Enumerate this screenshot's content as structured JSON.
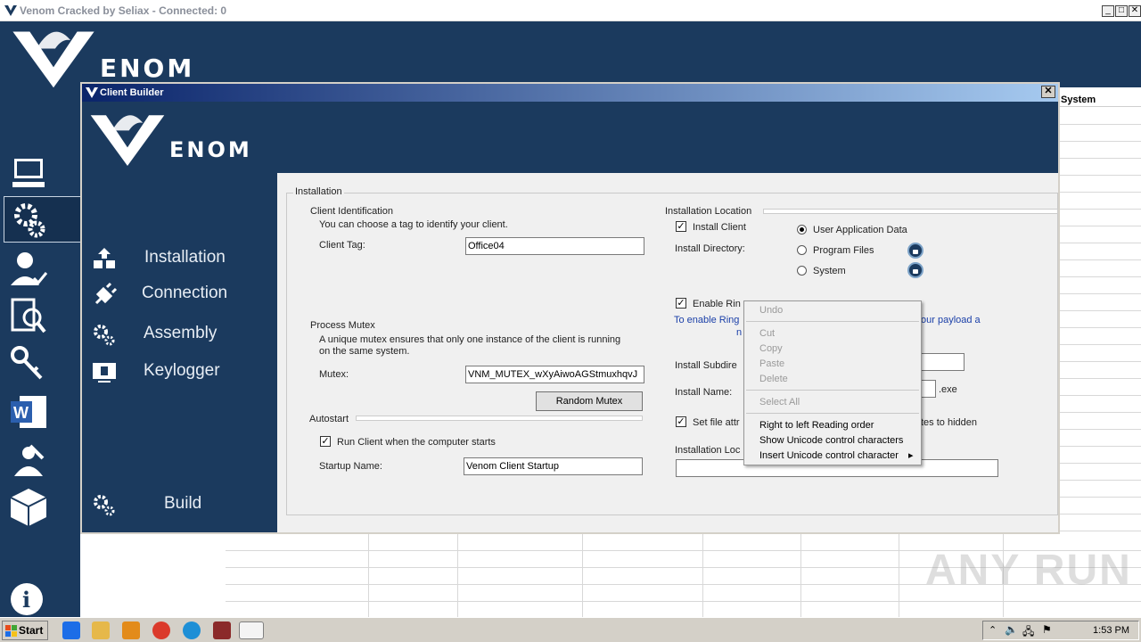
{
  "main_window": {
    "title": "Venom Cracked by Seliax - Connected: 0",
    "brand": "ENOM",
    "system_column_header": "System",
    "about_label": "About",
    "controls": {
      "minimize": "_",
      "maximize": "□",
      "close": "✕"
    }
  },
  "dialog": {
    "title": "Client Builder",
    "brand": "ENOM",
    "close_glyph": "✕",
    "nav": [
      {
        "label": "Installation",
        "icon": "upload-boxes-icon"
      },
      {
        "label": "Connection",
        "icon": "plug-icon"
      },
      {
        "label": "Assembly",
        "icon": "gears-icon"
      },
      {
        "label": "Keylogger",
        "icon": "keylogger-icon"
      }
    ],
    "build_label": "Build",
    "installation": {
      "group_title": "Installation",
      "client_id": {
        "title": "Client Identification",
        "desc": "You can choose a tag to identify your client.",
        "tag_label": "Client Tag:",
        "tag_value": "Office04"
      },
      "mutex": {
        "title": "Process Mutex",
        "desc_line1": "A unique mutex ensures that only one instance of the client is running",
        "desc_line2": "on the same system.",
        "mutex_label": "Mutex:",
        "mutex_value": "VNM_MUTEX_wXyAiwoAGStmuxhqvJ",
        "random_button": "Random Mutex"
      },
      "autostart": {
        "title": "Autostart",
        "run_on_start_label": "Run Client when the computer starts",
        "run_on_start_checked": true,
        "startup_name_label": "Startup Name:",
        "startup_name_value": "Venom Client Startup"
      },
      "location": {
        "title": "Installation Location",
        "install_client_label": "Install Client",
        "install_client_checked": true,
        "install_dir_label": "Install Directory:",
        "options": [
          "User Application Data",
          "Program Files",
          "System"
        ],
        "selected_option": "User Application Data",
        "enable_ring_label": "Enable Rin",
        "enable_ring_checked": true,
        "ring_note_left": "To enable Ring",
        "ring_note_left2": "n",
        "ring_note_right": "our payload a",
        "subdir_label": "Install Subdire",
        "install_name_label": "Install Name:",
        "exe_suffix": ".exe",
        "set_attr_label": "Set file attr",
        "set_attr_right": "tes to hidden",
        "set_attr_checked": true,
        "install_location_label": "Installation Loc"
      }
    }
  },
  "context_menu": {
    "undo": "Undo",
    "cut": "Cut",
    "copy": "Copy",
    "paste": "Paste",
    "delete": "Delete",
    "select_all": "Select All",
    "rtl": "Right to left Reading order",
    "show_unicode": "Show Unicode control characters",
    "insert_unicode": "Insert Unicode control character",
    "submenu_arrow": "▸"
  },
  "taskbar": {
    "start_label": "Start",
    "clock": "1:53 PM"
  },
  "watermark": "ANY RUN",
  "colors": {
    "navy": "#1b3a5e",
    "title_gradient_start": "#0a246a",
    "title_gradient_end": "#a6caf0",
    "content_bg": "#f0f0f0",
    "link_blue": "#1a3fa8"
  }
}
